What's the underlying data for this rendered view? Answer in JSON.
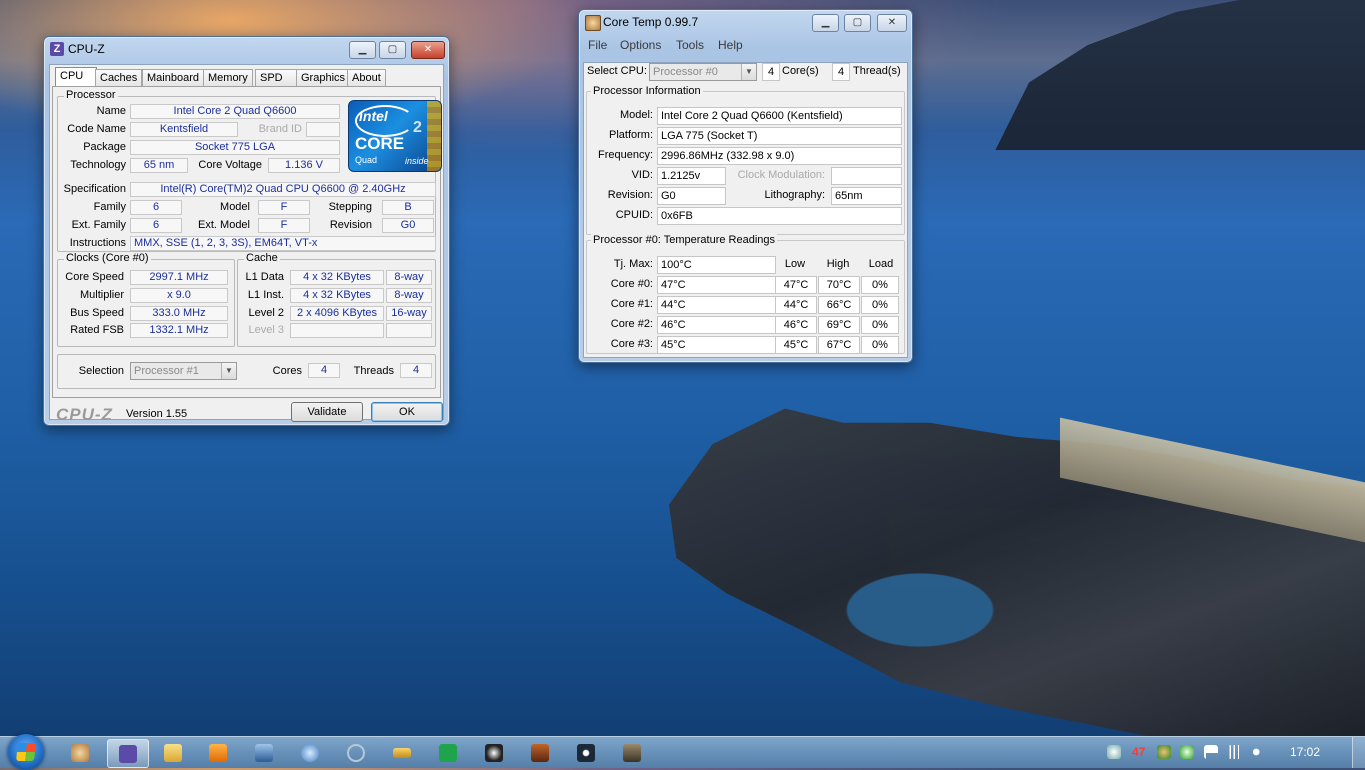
{
  "cpuz": {
    "title": "CPU-Z",
    "tabs": [
      "CPU",
      "Caches",
      "Mainboard",
      "Memory",
      "SPD",
      "Graphics",
      "About"
    ],
    "processor": {
      "group_title": "Processor",
      "name_label": "Name",
      "name": "Intel Core 2 Quad Q6600",
      "codename_label": "Code Name",
      "codename": "Kentsfield",
      "brandid_label": "Brand ID",
      "brandid": "",
      "package_label": "Package",
      "package": "Socket 775 LGA",
      "technology_label": "Technology",
      "technology": "65 nm",
      "core_voltage_label": "Core Voltage",
      "core_voltage": "1.136 V",
      "specification_label": "Specification",
      "specification": "Intel(R) Core(TM)2 Quad CPU    Q6600  @ 2.40GHz",
      "family_label": "Family",
      "family": "6",
      "model_label": "Model",
      "model": "F",
      "stepping_label": "Stepping",
      "stepping": "B",
      "ext_family_label": "Ext. Family",
      "ext_family": "6",
      "ext_model_label": "Ext. Model",
      "ext_model": "F",
      "revision_label": "Revision",
      "revision": "G0",
      "instructions_label": "Instructions",
      "instructions": "MMX, SSE (1, 2, 3, 3S), EM64T, VT-x"
    },
    "logo": {
      "brand": "intel",
      "line": "CORE",
      "sup": "2",
      "sub": "Quad",
      "inside": "inside"
    },
    "clocks": {
      "group_title": "Clocks (Core #0)",
      "core_speed_label": "Core Speed",
      "core_speed": "2997.1 MHz",
      "multiplier_label": "Multiplier",
      "multiplier": "x 9.0",
      "bus_speed_label": "Bus Speed",
      "bus_speed": "333.0 MHz",
      "rated_fsb_label": "Rated FSB",
      "rated_fsb": "1332.1 MHz"
    },
    "cache": {
      "group_title": "Cache",
      "l1_data_label": "L1 Data",
      "l1_data": "4 x 32 KBytes",
      "l1_data_way": "8-way",
      "l1_inst_label": "L1 Inst.",
      "l1_inst": "4 x 32 KBytes",
      "l1_inst_way": "8-way",
      "level2_label": "Level 2",
      "level2": "2 x 4096 KBytes",
      "level2_way": "16-way",
      "level3_label": "Level 3",
      "level3": "",
      "level3_way": ""
    },
    "selection": {
      "label": "Selection",
      "value": "Processor #1",
      "cores_label": "Cores",
      "cores": "4",
      "threads_label": "Threads",
      "threads": "4"
    },
    "footer": {
      "brand": "CPU-Z",
      "version": "Version 1.55",
      "validate": "Validate",
      "ok": "OK"
    }
  },
  "coretemp": {
    "title": "Core Temp 0.99.7",
    "menu": [
      "File",
      "Options",
      "Tools",
      "Help"
    ],
    "select_cpu_label": "Select CPU:",
    "select_cpu": "Processor #0",
    "cores_count": "4",
    "cores_label": "Core(s)",
    "threads_count": "4",
    "threads_label": "Thread(s)",
    "info": {
      "group_title": "Processor Information",
      "model_label": "Model:",
      "model": "Intel Core 2 Quad Q6600 (Kentsfield)",
      "platform_label": "Platform:",
      "platform": "LGA 775 (Socket T)",
      "frequency_label": "Frequency:",
      "frequency": "2996.86MHz (332.98 x 9.0)",
      "vid_label": "VID:",
      "vid": "1.2125v",
      "clock_mod_label": "Clock Modulation:",
      "clock_mod": "",
      "revision_label": "Revision:",
      "revision": "G0",
      "litho_label": "Lithography:",
      "litho": "65nm",
      "cpuid_label": "CPUID:",
      "cpuid": "0x6FB"
    },
    "temps": {
      "group_title": "Processor #0: Temperature Readings",
      "tjmax_label": "Tj. Max:",
      "tjmax": "100°C",
      "headers": {
        "low": "Low",
        "high": "High",
        "load": "Load"
      },
      "rows": [
        {
          "label": "Core #0:",
          "temp": "47°C",
          "low": "47°C",
          "high": "70°C",
          "load": "0%"
        },
        {
          "label": "Core #1:",
          "temp": "44°C",
          "low": "44°C",
          "high": "66°C",
          "load": "0%"
        },
        {
          "label": "Core #2:",
          "temp": "46°C",
          "low": "46°C",
          "high": "69°C",
          "load": "0%"
        },
        {
          "label": "Core #3:",
          "temp": "45°C",
          "low": "45°C",
          "high": "67°C",
          "load": "0%"
        }
      ]
    }
  },
  "taskbar": {
    "items": [
      "core-temp",
      "cpu-z",
      "explorer",
      "media-player",
      "app-blue",
      "app-globe",
      "app-swirl",
      "app-glasses",
      "app-green",
      "app-mask",
      "app-game",
      "steam",
      "app-game-2"
    ],
    "tray_temp": "47",
    "clock": "17:02"
  },
  "colors": {
    "value_text": "#1b2f9c",
    "accent": "#1f6ac2"
  }
}
